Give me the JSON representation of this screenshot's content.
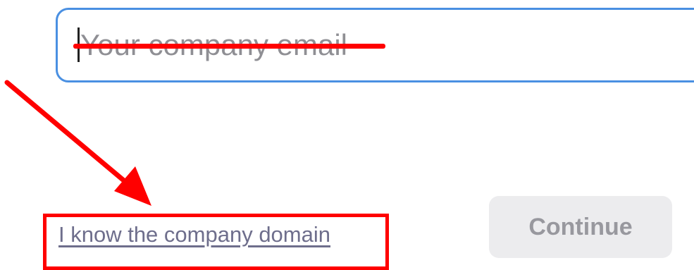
{
  "email_field": {
    "placeholder": "Your company email",
    "value": ""
  },
  "annotations": {
    "color": "#ff0000",
    "strikethrough_on": "email placeholder",
    "arrow_target": "company domain link",
    "highlight_box_on": "company domain link"
  },
  "link": {
    "label": "I know the company domain",
    "color": "#6e6e8c"
  },
  "continue_button": {
    "label": "Continue",
    "state": "disabled"
  },
  "colors": {
    "field_border": "#4a90e2",
    "button_bg": "#ececee",
    "button_text": "#98989e"
  }
}
